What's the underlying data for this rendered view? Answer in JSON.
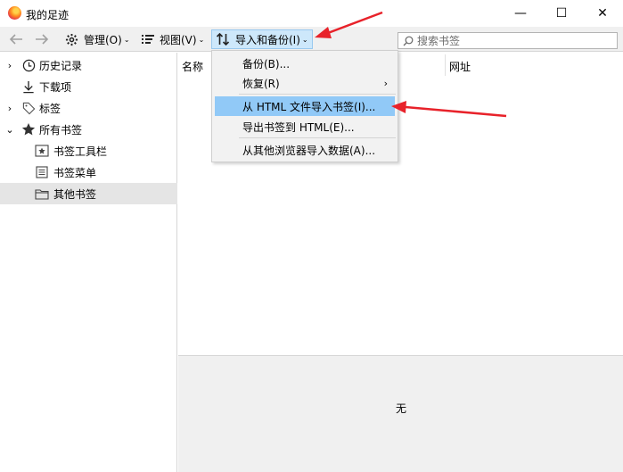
{
  "window": {
    "title": "我的足迹",
    "min_symbol": "—",
    "max_symbol": "☐",
    "close_symbol": "✕"
  },
  "toolbar": {
    "back_icon": "arrow-left-icon",
    "forward_icon": "arrow-right-icon",
    "organize_label": "管理(O)",
    "views_label": "视图(V)",
    "import_label": "导入和备份(I)",
    "caret": "⌄"
  },
  "search": {
    "placeholder": "搜索书签",
    "value": ""
  },
  "sidebar": {
    "items": [
      {
        "label": "历史记录",
        "icon": "clock-icon",
        "twisty": "›"
      },
      {
        "label": "下载项",
        "icon": "download-icon",
        "twisty": ""
      },
      {
        "label": "标签",
        "icon": "tag-icon",
        "twisty": "›"
      },
      {
        "label": "所有书签",
        "icon": "star-icon",
        "twisty": "⌄"
      },
      {
        "label": "书签工具栏",
        "icon": "toolbar-folder-icon",
        "twisty": ""
      },
      {
        "label": "书签菜单",
        "icon": "menu-folder-icon",
        "twisty": ""
      },
      {
        "label": "其他书签",
        "icon": "folder-icon",
        "twisty": ""
      }
    ],
    "selected": "其他书签"
  },
  "list": {
    "columns": [
      "名称",
      "网址"
    ]
  },
  "details": {
    "empty_text": "无"
  },
  "menu": {
    "items": [
      {
        "label": "备份(B)..."
      },
      {
        "label": "恢复(R)",
        "submenu": "›"
      },
      {
        "label": "从 HTML 文件导入书签(I)..."
      },
      {
        "label": "导出书签到 HTML(E)..."
      },
      {
        "label": "从其他浏览器导入数据(A)..."
      }
    ],
    "highlighted": "从 HTML 文件导入书签(I)..."
  },
  "colors": {
    "annotation": "#e8222a",
    "menu_highlight": "#91c9f7",
    "button_active": "#cde8fb"
  }
}
